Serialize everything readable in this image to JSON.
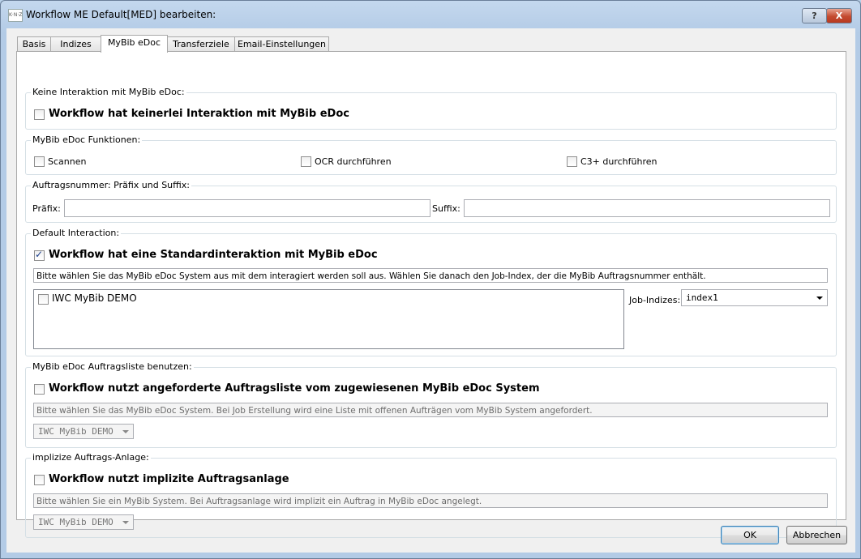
{
  "window": {
    "title": "Workflow ME Default[MED] bearbeiten:",
    "help_label": "?",
    "close_label": "X",
    "icon_text": "K·N·Z"
  },
  "tabs": [
    {
      "label": "Basis"
    },
    {
      "label": "Indizes"
    },
    {
      "label": "MyBib eDoc",
      "active": true
    },
    {
      "label": "Transferziele"
    },
    {
      "label": "Email-Einstellungen"
    }
  ],
  "no_interaction": {
    "group_label": "Keine Interaktion mit MyBib eDoc:",
    "checkbox_label": "Workflow hat keinerlei Interaktion mit MyBib eDoc",
    "checked": false
  },
  "functions": {
    "group_label": "MyBib eDoc Funktionen:",
    "scan_label": "Scannen",
    "ocr_label": "OCR durchführen",
    "c3_label": "C3+ durchführen"
  },
  "order_number": {
    "group_label": "Auftragsnummer: Präfix und Suffix:",
    "prefix_label": "Präfix:",
    "prefix_value": "",
    "suffix_label": "Suffix:",
    "suffix_value": ""
  },
  "default_interaction": {
    "group_label": "Default Interaction:",
    "checkbox_label": "Workflow hat eine Standardinteraktion mit MyBib eDoc",
    "checked": true,
    "info": "Bitte wählen Sie das MyBib eDoc System aus mit dem interagiert werden soll aus. Wählen Sie danach den Job-Index, der die MyBib Auftragsnummer enthält.",
    "systems": [
      {
        "label": "IWC MyBib DEMO",
        "checked": false
      }
    ],
    "job_index_label": "Job-Indizes:",
    "job_index_value": "index1"
  },
  "order_list": {
    "group_label": "MyBib eDoc Auftragsliste benutzen:",
    "checkbox_label": "Workflow nutzt angeforderte Auftragsliste vom zugewiesenen MyBib eDoc System",
    "info": "Bitte wählen Sie das MyBib eDoc System. Bei Job Erstellung wird eine Liste mit offenen Aufträgen vom MyBib System angefordert.",
    "system_value": "IWC MyBib DEMO"
  },
  "implicit_order": {
    "group_label": "implizize Auftrags-Anlage:",
    "checkbox_label": "Workflow nutzt implizite Auftragsanlage",
    "info": "Bitte wählen Sie ein MyBib System. Bei Auftragsanlage wird implizit ein Auftrag in MyBib eDoc angelegt.",
    "system_value": "IWC MyBib DEMO"
  },
  "buttons": {
    "ok": "OK",
    "cancel": "Abbrechen"
  }
}
